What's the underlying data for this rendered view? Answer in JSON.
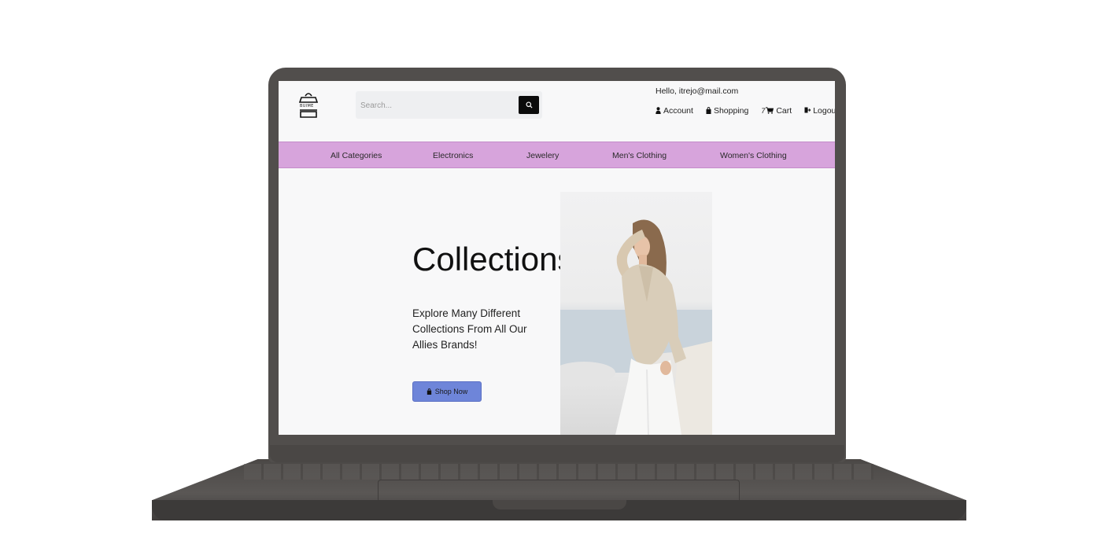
{
  "header": {
    "logo_text": "BUIME",
    "search": {
      "placeholder": "Search..."
    },
    "greeting": "Hello, itrejo@mail.com",
    "user_nav": [
      {
        "label": "Account",
        "icon": "user-icon"
      },
      {
        "label": "Shopping",
        "icon": "bag-icon"
      },
      {
        "label": "Cart",
        "icon": "cart-icon",
        "count": "7"
      },
      {
        "label": "Logout",
        "icon": "logout-icon"
      }
    ]
  },
  "categories": [
    "All Categories",
    "Electronics",
    "Jewelery",
    "Men's Clothing",
    "Women's Clothing"
  ],
  "hero": {
    "title": "Collections",
    "subtitle": "Explore Many Different Collections From All Our Allies Brands!",
    "button_label": "Shop Now",
    "button_icon": "bag-icon"
  },
  "colors": {
    "category_bar": "#d7a4dc",
    "shop_button": "#6e85d9",
    "search_button": "#0b0b0b",
    "laptop_body": "#514e4c"
  }
}
